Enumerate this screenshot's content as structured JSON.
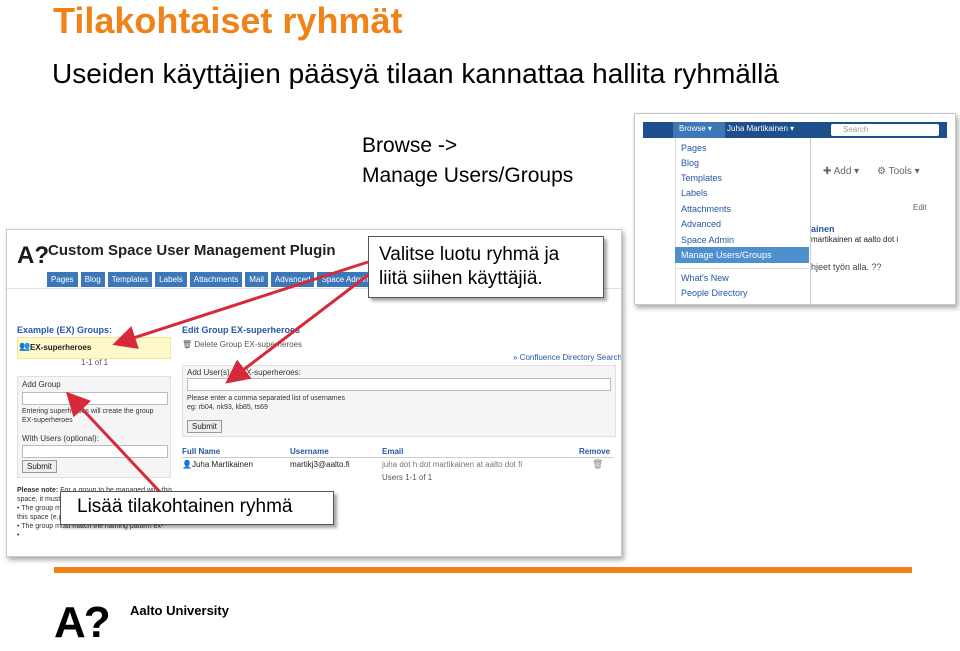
{
  "slide": {
    "title": "Tilakohtaiset ryhmät",
    "subtitle": "Useiden käyttäjien pääsyä tilaan kannattaa hallita ryhmällä",
    "browse_path_line1": "Browse ->",
    "browse_path_line2": "Manage Users/Groups",
    "callout_select": "Valitse luotu ryhmä ja liitä siihen käyttäjiä.",
    "callout_add": "Lisää tilakohtainen ryhmä",
    "accent_color": "#f08317",
    "footer": {
      "logo": "A?",
      "brand": "Aalto University"
    }
  },
  "plugin_screenshot": {
    "logo": "A?",
    "title": "Custom Space User Management Plugin",
    "tabs": [
      "Pages",
      "Blog",
      "Templates",
      "Labels",
      "Attachments",
      "Mail",
      "Advanced",
      "Space Admin"
    ],
    "groups_heading": "Example (EX) Groups:",
    "group_name": "EX-superheroes",
    "left_pager": "1-1 of 1",
    "add_group": {
      "label": "Add Group",
      "help": "Entering superheroes will create the group EX-superheroes",
      "with_users_label": "With Users (optional):",
      "submit_label": "Submit"
    },
    "note": {
      "bold": "Please note:",
      "lines": [
        "For a group to be managed with this space, it must meet the following requirements:",
        "• The group must be",
        "  this space (e.g.",
        "• The group must match the naming pattern ex-",
        "•"
      ]
    },
    "edit_heading": "Edit Group EX-superheroes",
    "delete_link": "Delete Group EX-superheroes",
    "search_link": "» Confluence Directory Search",
    "add_users": {
      "label": "Add User(s) to EX-superheroes:",
      "help_line1": "Please enter a comma separated list of usernames",
      "help_line2": "eg: rb04, nk93, kb85, ts69",
      "submit_label": "Submit"
    },
    "table": {
      "columns": [
        "Full Name",
        "Username",
        "Email",
        "Remove"
      ],
      "rows": [
        {
          "full_name": "Juha Martikainen",
          "username": "martikj3@aalto.fi",
          "email": "juha dot h dot martikainen at aalto dot fi"
        }
      ],
      "pager": "Users 1-1 of 1"
    }
  },
  "browse_screenshot": {
    "browse_label": "Browse ▾",
    "user_label": "Juha Martikainen ▾",
    "search_placeholder": "Search",
    "menu_items": [
      "Pages",
      "Blog",
      "Templates",
      "Labels",
      "Attachments",
      "Advanced",
      "Space Admin",
      "Manage Users/Groups"
    ],
    "menu_items_bottom": [
      "What's New",
      "People Directory"
    ],
    "add_label": "Add ▾",
    "tools_label": "Tools ▾",
    "edit_label": "Edit",
    "content_line1": "ainen",
    "content_line2": "martikainen at aalto dot i",
    "content_line3": "hjeet työn alla. ??"
  }
}
